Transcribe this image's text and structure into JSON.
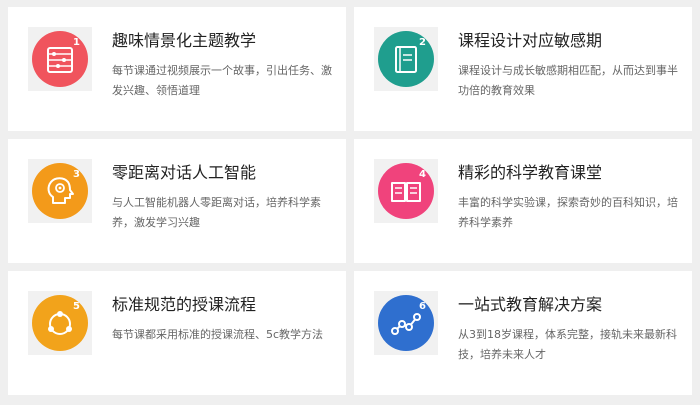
{
  "features": [
    {
      "number": "1",
      "title": "趣味情景化主题教学",
      "desc": "每节课通过视频展示一个故事，引出任务、激发兴趣、领悟道理",
      "icon": "abacus-icon",
      "color": "#f0545d"
    },
    {
      "number": "2",
      "title": "课程设计对应敏感期",
      "desc": "课程设计与成长敏感期相匹配，从而达到事半功倍的教育效果",
      "icon": "notebook-icon",
      "color": "#1f9e8e"
    },
    {
      "number": "3",
      "title": "零距离对话人工智能",
      "desc": "与人工智能机器人零距离对话，培养科学素养，激发学习兴趣",
      "icon": "brain-head-icon",
      "color": "#f39a1a"
    },
    {
      "number": "4",
      "title": "精彩的科学教育课堂",
      "desc": "丰富的科学实验课，探索奇妙的百科知识，培养科学素养",
      "icon": "open-book-icon",
      "color": "#f0437c"
    },
    {
      "number": "5",
      "title": "标准规范的授课流程",
      "desc": "每节课都采用标准的授课流程、5c教学方法",
      "icon": "cycle-flow-icon",
      "color": "#f2a31b"
    },
    {
      "number": "6",
      "title": "一站式教育解决方案",
      "desc": "从3到18岁课程，体系完整，接轨未来最新科技，培养未来人才",
      "icon": "growth-path-icon",
      "color": "#2f6fcf"
    }
  ]
}
